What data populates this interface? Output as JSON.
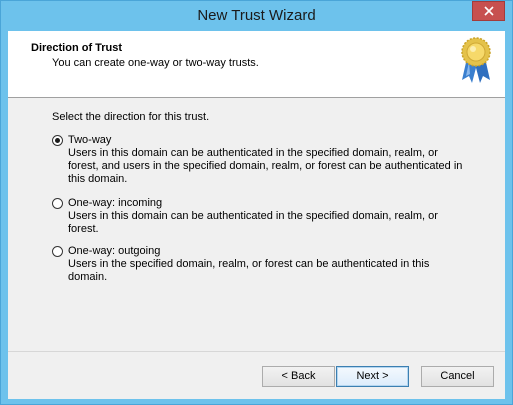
{
  "window": {
    "title": "New Trust Wizard"
  },
  "header": {
    "title": "Direction of Trust",
    "subtitle": "You can create one-way or two-way trusts.",
    "icon": "award-ribbon-icon"
  },
  "main": {
    "prompt": "Select the direction for this trust.",
    "options": [
      {
        "label": "Two-way",
        "selected": true,
        "description": "Users in this domain can be authenticated in the specified domain, realm, or forest, and users in the specified domain, realm, or forest can be authenticated in this domain."
      },
      {
        "label": "One-way: incoming",
        "selected": false,
        "description": "Users in this domain can be authenticated in the specified domain, realm, or forest."
      },
      {
        "label": "One-way: outgoing",
        "selected": false,
        "description": "Users in the specified domain, realm, or forest can be authenticated in this domain."
      }
    ]
  },
  "footer": {
    "back_label": "< Back",
    "next_label": "Next >",
    "cancel_label": "Cancel"
  },
  "colors": {
    "frame": "#6dc2ec",
    "close_button": "#c7504f",
    "dialog_bg": "#f0f0f0"
  }
}
